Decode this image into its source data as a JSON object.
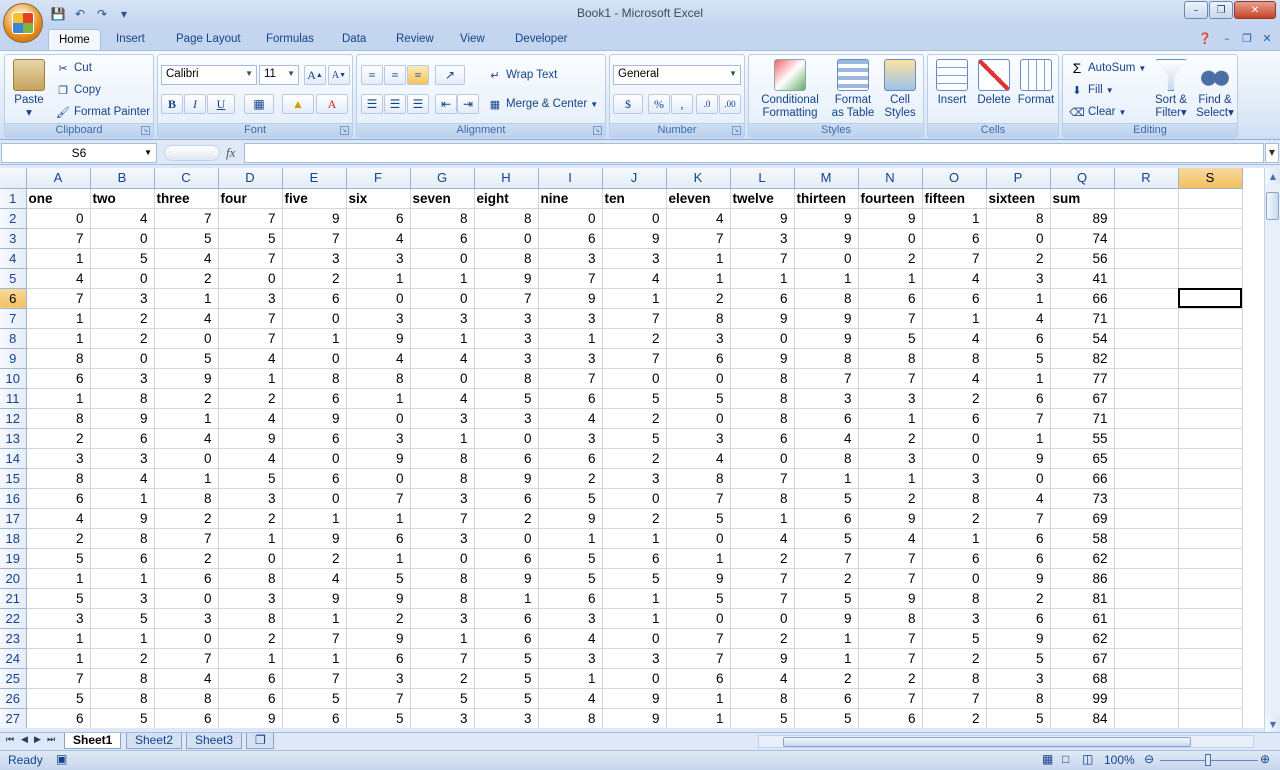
{
  "window": {
    "title": "Book1 - Microsoft Excel"
  },
  "tabs": [
    "Home",
    "Insert",
    "Page Layout",
    "Formulas",
    "Data",
    "Review",
    "View",
    "Developer"
  ],
  "ribbon": {
    "clipboard": {
      "label": "Clipboard",
      "paste": "Paste",
      "cut": "Cut",
      "copy": "Copy",
      "format_painter": "Format Painter"
    },
    "font": {
      "label": "Font",
      "name": "Calibri",
      "size": "11"
    },
    "alignment": {
      "label": "Alignment",
      "wrap_text": "Wrap Text",
      "merge_center": "Merge & Center"
    },
    "number": {
      "label": "Number",
      "format": "General"
    },
    "styles": {
      "label": "Styles",
      "conditional_1": "Conditional",
      "conditional_2": "Formatting",
      "format_table_1": "Format",
      "format_table_2": "as Table",
      "cell_styles_1": "Cell",
      "cell_styles_2": "Styles"
    },
    "cells": {
      "label": "Cells",
      "insert": "Insert",
      "delete": "Delete",
      "format": "Format"
    },
    "editing": {
      "label": "Editing",
      "autosum": "AutoSum",
      "fill": "Fill",
      "clear": "Clear",
      "sort_1": "Sort &",
      "sort_2": "Filter",
      "find_1": "Find &",
      "find_2": "Select"
    }
  },
  "formula_bar": {
    "name_box": "S6",
    "fx": "fx",
    "formula": ""
  },
  "grid": {
    "columns": [
      "A",
      "B",
      "C",
      "D",
      "E",
      "F",
      "G",
      "H",
      "I",
      "J",
      "K",
      "L",
      "M",
      "N",
      "O",
      "P",
      "Q",
      "R",
      "S"
    ],
    "selected_column": "S",
    "selected_row": 6,
    "headers": [
      "one",
      "two",
      "three",
      "four",
      "five",
      "six",
      "seven",
      "eight",
      "nine",
      "ten",
      "eleven",
      "twelve",
      "thirteen",
      "fourteen",
      "fifteen",
      "sixteen",
      "sum"
    ],
    "rows": [
      [
        0,
        4,
        7,
        7,
        9,
        6,
        8,
        8,
        0,
        0,
        4,
        9,
        9,
        9,
        1,
        8,
        89
      ],
      [
        7,
        0,
        5,
        5,
        7,
        4,
        6,
        0,
        6,
        9,
        7,
        3,
        9,
        0,
        6,
        0,
        74
      ],
      [
        1,
        5,
        4,
        7,
        3,
        3,
        0,
        8,
        3,
        3,
        1,
        7,
        0,
        2,
        7,
        2,
        56
      ],
      [
        4,
        0,
        2,
        0,
        2,
        1,
        1,
        9,
        7,
        4,
        1,
        1,
        1,
        1,
        4,
        3,
        41
      ],
      [
        7,
        3,
        1,
        3,
        6,
        0,
        0,
        7,
        9,
        1,
        2,
        6,
        8,
        6,
        6,
        1,
        66
      ],
      [
        1,
        2,
        4,
        7,
        0,
        3,
        3,
        3,
        3,
        7,
        8,
        9,
        9,
        7,
        1,
        4,
        71
      ],
      [
        1,
        2,
        0,
        7,
        1,
        9,
        1,
        3,
        1,
        2,
        3,
        0,
        9,
        5,
        4,
        6,
        54
      ],
      [
        8,
        0,
        5,
        4,
        0,
        4,
        4,
        3,
        3,
        7,
        6,
        9,
        8,
        8,
        8,
        5,
        82
      ],
      [
        6,
        3,
        9,
        1,
        8,
        8,
        0,
        8,
        7,
        0,
        0,
        8,
        7,
        7,
        4,
        1,
        77
      ],
      [
        1,
        8,
        2,
        2,
        6,
        1,
        4,
        5,
        6,
        5,
        5,
        8,
        3,
        3,
        2,
        6,
        67
      ],
      [
        8,
        9,
        1,
        4,
        9,
        0,
        3,
        3,
        4,
        2,
        0,
        8,
        6,
        1,
        6,
        7,
        71
      ],
      [
        2,
        6,
        4,
        9,
        6,
        3,
        1,
        0,
        3,
        5,
        3,
        6,
        4,
        2,
        0,
        1,
        55
      ],
      [
        3,
        3,
        0,
        4,
        0,
        9,
        8,
        6,
        6,
        2,
        4,
        0,
        8,
        3,
        0,
        9,
        65
      ],
      [
        8,
        4,
        1,
        5,
        6,
        0,
        8,
        9,
        2,
        3,
        8,
        7,
        1,
        1,
        3,
        0,
        66
      ],
      [
        6,
        1,
        8,
        3,
        0,
        7,
        3,
        6,
        5,
        0,
        7,
        8,
        5,
        2,
        8,
        4,
        73
      ],
      [
        4,
        9,
        2,
        2,
        1,
        1,
        7,
        2,
        9,
        2,
        5,
        1,
        6,
        9,
        2,
        7,
        69
      ],
      [
        2,
        8,
        7,
        1,
        9,
        6,
        3,
        0,
        1,
        1,
        0,
        4,
        5,
        4,
        1,
        6,
        58
      ],
      [
        5,
        6,
        2,
        0,
        2,
        1,
        0,
        6,
        5,
        6,
        1,
        2,
        7,
        7,
        6,
        6,
        62
      ],
      [
        1,
        1,
        6,
        8,
        4,
        5,
        8,
        9,
        5,
        5,
        9,
        7,
        2,
        7,
        0,
        9,
        86
      ],
      [
        5,
        3,
        0,
        3,
        9,
        9,
        8,
        1,
        6,
        1,
        5,
        7,
        5,
        9,
        8,
        2,
        81
      ],
      [
        3,
        5,
        3,
        8,
        1,
        2,
        3,
        6,
        3,
        1,
        0,
        0,
        9,
        8,
        3,
        6,
        61
      ],
      [
        1,
        1,
        0,
        2,
        7,
        9,
        1,
        6,
        4,
        0,
        7,
        2,
        1,
        7,
        5,
        9,
        62
      ],
      [
        1,
        2,
        7,
        1,
        1,
        6,
        7,
        5,
        3,
        3,
        7,
        9,
        1,
        7,
        2,
        5,
        67
      ],
      [
        7,
        8,
        4,
        6,
        7,
        3,
        2,
        5,
        1,
        0,
        6,
        4,
        2,
        2,
        8,
        3,
        68
      ],
      [
        5,
        8,
        8,
        6,
        5,
        7,
        5,
        5,
        4,
        9,
        1,
        8,
        6,
        7,
        7,
        8,
        99
      ],
      [
        6,
        5,
        6,
        9,
        6,
        5,
        3,
        3,
        8,
        9,
        1,
        5,
        5,
        6,
        2,
        5,
        84
      ]
    ]
  },
  "sheets": [
    "Sheet1",
    "Sheet2",
    "Sheet3"
  ],
  "status": {
    "text": "Ready",
    "zoom": "100%"
  }
}
